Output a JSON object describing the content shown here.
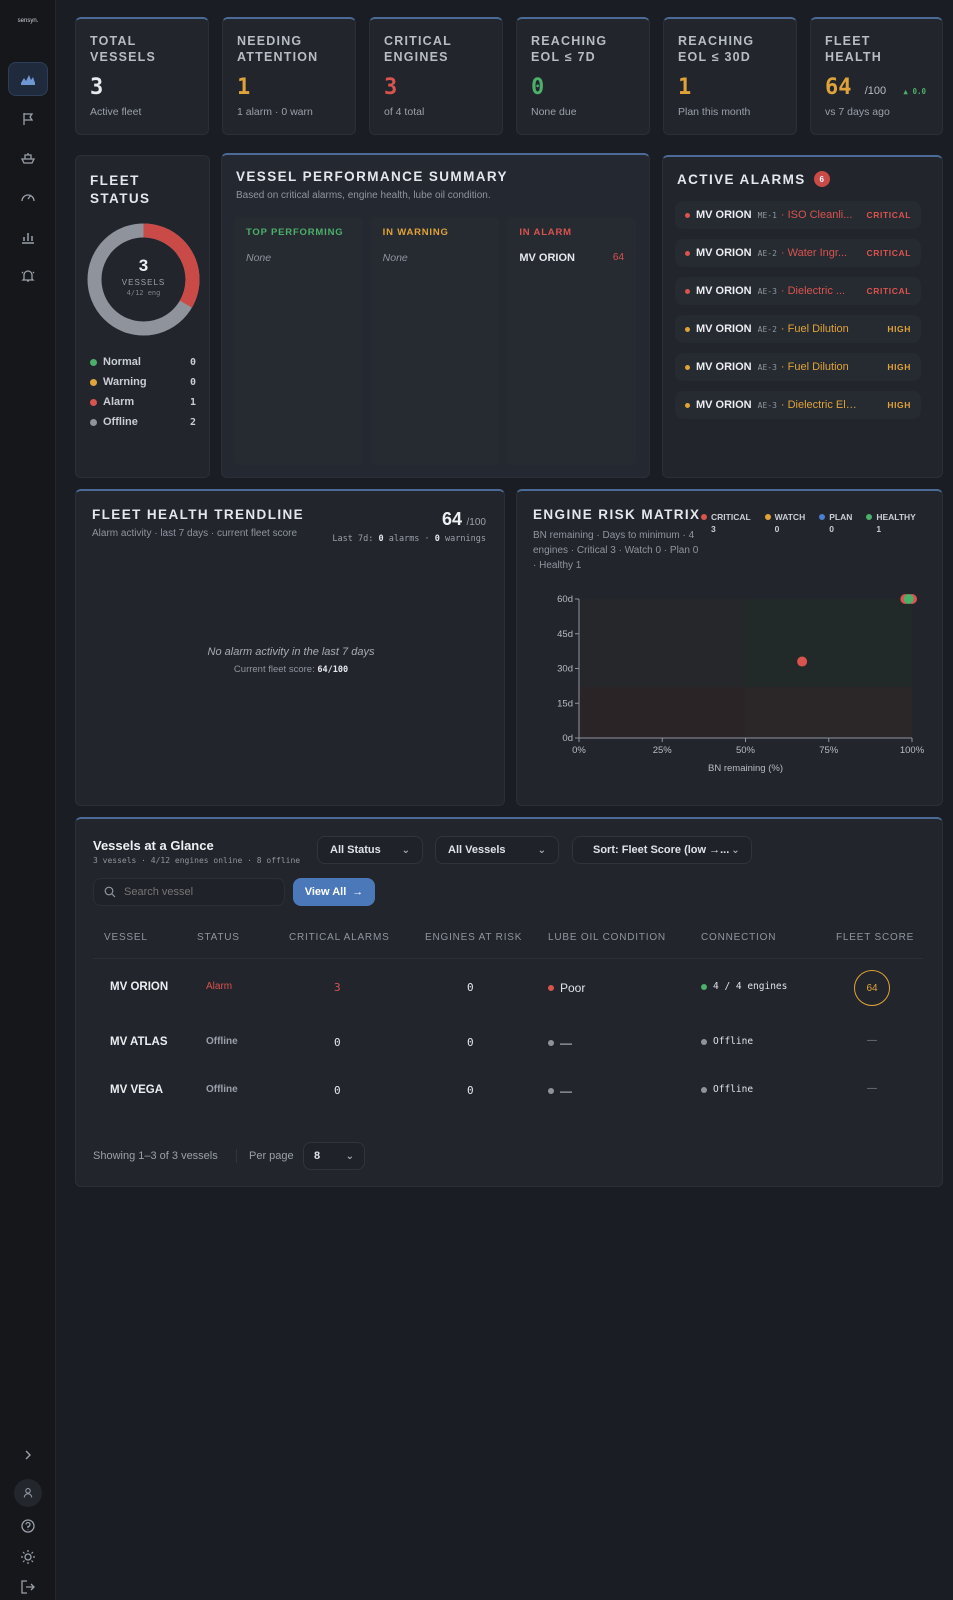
{
  "app": {
    "logo": "sensyn."
  },
  "sidebar": {
    "nav": [
      {
        "name": "dashboard-icon",
        "active": true
      },
      {
        "name": "flag-icon"
      },
      {
        "name": "ship-icon"
      },
      {
        "name": "gauge-icon"
      },
      {
        "name": "analytics-icon"
      },
      {
        "name": "alarm-bell-icon"
      }
    ],
    "bottom": [
      "expand-icon",
      "user-icon",
      "help-icon",
      "theme-icon",
      "logout-icon"
    ]
  },
  "kpis": [
    {
      "label": "TOTAL VESSELS",
      "value": "3",
      "sub": "Active fleet",
      "color": "#e8eaee"
    },
    {
      "label": "NEEDING ATTENTION",
      "value": "1",
      "sub": "1 alarm · 0 warn",
      "color": "#e0a33a"
    },
    {
      "label": "CRITICAL ENGINES",
      "value": "3",
      "sub": "of 4 total",
      "color": "#d9534f"
    },
    {
      "label": "REACHING EOL ≤ 7D",
      "value": "0",
      "sub": "None due",
      "color": "#4caf6a"
    },
    {
      "label": "REACHING EOL ≤ 30D",
      "value": "1",
      "sub": "Plan this month",
      "color": "#e0a33a"
    },
    {
      "label": "FLEET HEALTH",
      "value": "64",
      "unit": "/100",
      "delta": "▲ 0.0",
      "sub": "vs 7 days ago",
      "color": "#e0a33a"
    }
  ],
  "fleet_status": {
    "title": "FLEET STATUS",
    "center_value": "3",
    "center_label": "VESSELS",
    "center_sub": "4/12 eng",
    "items": [
      {
        "label": "Normal",
        "count": "0",
        "color": "#4caf6a"
      },
      {
        "label": "Warning",
        "count": "0",
        "color": "#e0a33a"
      },
      {
        "label": "Alarm",
        "count": "1",
        "color": "#d9534f"
      },
      {
        "label": "Offline",
        "count": "2",
        "color": "#8f949c"
      }
    ],
    "donut": {
      "alarm": 1,
      "offline": 2
    }
  },
  "performance": {
    "title": "VESSEL PERFORMANCE SUMMARY",
    "subtitle": "Based on critical alarms, engine health, lube oil condition.",
    "columns": [
      {
        "label": "TOP PERFORMING",
        "color": "#4caf6a",
        "empty": "None"
      },
      {
        "label": "IN WARNING",
        "color": "#e0a33a",
        "empty": "None"
      },
      {
        "label": "IN ALARM",
        "color": "#d9534f",
        "vessel": "MV ORION",
        "score": "64"
      }
    ]
  },
  "alarms": {
    "title": "ACTIVE ALARMS",
    "count": "6",
    "items": [
      {
        "vessel": "MV ORION",
        "engine": "ME-1",
        "text": "· ISO Cleanli...",
        "severity": "CRITICAL",
        "color": "#d9534f"
      },
      {
        "vessel": "MV ORION",
        "engine": "AE-2",
        "text": "· Water Ingr...",
        "severity": "CRITICAL",
        "color": "#d9534f"
      },
      {
        "vessel": "MV ORION",
        "engine": "AE-3",
        "text": "· Dielectric ...",
        "severity": "CRITICAL",
        "color": "#d9534f"
      },
      {
        "vessel": "MV ORION",
        "engine": "AE-2",
        "text": "· Fuel Dilution",
        "severity": "HIGH",
        "color": "#e0a33a"
      },
      {
        "vessel": "MV ORION",
        "engine": "AE-3",
        "text": "· Fuel Dilution",
        "severity": "HIGH",
        "color": "#e0a33a"
      },
      {
        "vessel": "MV ORION",
        "engine": "AE-3",
        "text": "· Dielectric Elev...",
        "severity": "HIGH",
        "color": "#e0a33a"
      }
    ]
  },
  "trend": {
    "title": "FLEET HEALTH TRENDLINE",
    "subtitle": "Alarm activity · last 7 days · current fleet score",
    "score": "64",
    "score_unit": "/100",
    "last7_prefix": "Last 7d:",
    "alarms_count": "0",
    "alarms_label": "alarms ·",
    "warnings_count": "0",
    "warnings_label": "warnings",
    "empty_title": "No alarm activity in the last 7 days",
    "empty_sub_prefix": "Current fleet score:",
    "empty_sub_value": "64/100"
  },
  "risk": {
    "title": "ENGINE RISK MATRIX",
    "subtitle": "BN remaining · Days to minimum · 4 engines · Critical 3 · Watch 0 · Plan 0 · Healthy 1",
    "legend": [
      {
        "label": "CRITICAL",
        "count": "3",
        "color": "#d9534f"
      },
      {
        "label": "WATCH",
        "count": "0",
        "color": "#e0a33a"
      },
      {
        "label": "PLAN",
        "count": "0",
        "color": "#4a7fd1"
      },
      {
        "label": "HEALTHY",
        "count": "1",
        "color": "#4caf6a"
      }
    ],
    "chart_data": {
      "type": "scatter",
      "xlabel": "BN remaining (%)",
      "xlim": [
        0,
        100
      ],
      "ylim": [
        0,
        60
      ],
      "x_ticks": [
        "0%",
        "25%",
        "50%",
        "75%",
        "100%"
      ],
      "y_ticks": [
        "0d",
        "15d",
        "30d",
        "45d",
        "60d"
      ],
      "points": [
        {
          "x": 67,
          "y": 33,
          "status": "critical"
        },
        {
          "x": 98,
          "y": 60,
          "status": "critical"
        },
        {
          "x": 100,
          "y": 60,
          "status": "critical"
        },
        {
          "x": 99,
          "y": 60,
          "status": "healthy"
        }
      ]
    }
  },
  "glance": {
    "title": "Vessels at a Glance",
    "subtitle": "3 vessels · 4/12 engines online · 8 offline",
    "filter_status": "All Status",
    "filter_vessels": "All Vessels",
    "sort": "Sort: Fleet Score (low →...",
    "search_placeholder": "Search vessel",
    "view_all": "View All",
    "columns": [
      "VESSEL",
      "STATUS",
      "CRITICAL ALARMS",
      "ENGINES AT RISK",
      "LUBE OIL CONDITION",
      "CONNECTION",
      "FLEET SCORE"
    ],
    "rows": [
      {
        "vessel": "MV ORION",
        "status": "Alarm",
        "status_color": "#d9534f",
        "critical": "3",
        "critical_color": "#d9534f",
        "risk": "0",
        "lube": "Poor",
        "lube_color": "#d9534f",
        "conn": "4 / 4 engines",
        "conn_color": "#4caf6a",
        "score": "64"
      },
      {
        "vessel": "MV ATLAS",
        "status": "Offline",
        "status_color": "#9aa0aa",
        "critical": "0",
        "critical_color": "#e6e8ec",
        "risk": "0",
        "lube": "—",
        "lube_color": "#8f949c",
        "conn": "Offline",
        "conn_color": "#8f949c",
        "score": "—"
      },
      {
        "vessel": "MV VEGA",
        "status": "Offline",
        "status_color": "#9aa0aa",
        "critical": "0",
        "critical_color": "#e6e8ec",
        "risk": "0",
        "lube": "—",
        "lube_color": "#8f949c",
        "conn": "Offline",
        "conn_color": "#8f949c",
        "score": "—"
      }
    ],
    "showing": "Showing 1–3 of 3 vessels",
    "per_page_label": "Per page",
    "per_page": "8"
  }
}
